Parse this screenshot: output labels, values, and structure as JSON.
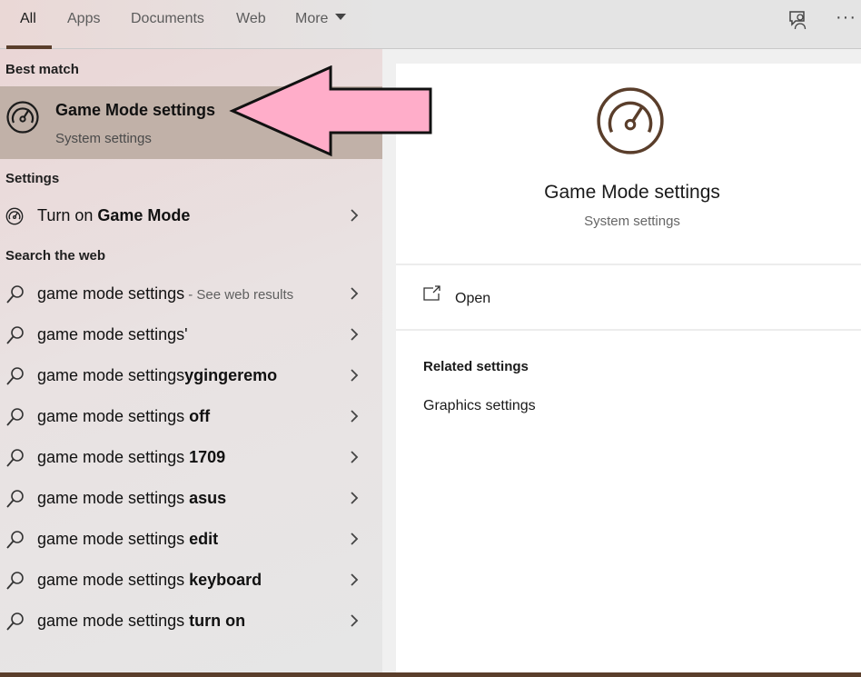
{
  "tabs": [
    {
      "label": "All",
      "active": true
    },
    {
      "label": "Apps"
    },
    {
      "label": "Documents"
    },
    {
      "label": "Web"
    },
    {
      "label": "More"
    }
  ],
  "top_icons": [
    "feedback-icon",
    "more-options-icon"
  ],
  "top_more_glyph": "···",
  "sections": {
    "best_match": "Best match",
    "settings": "Settings",
    "search_web": "Search the web"
  },
  "best_match": {
    "title": "Game Mode settings",
    "subtitle": "System settings",
    "icon": "speedometer-icon"
  },
  "settings_result": {
    "prefix": "Turn on ",
    "bold": "Game Mode"
  },
  "web_results": [
    {
      "prefix": "game mode settings",
      "bold": "",
      "hint": " - See web results"
    },
    {
      "prefix": "game mode settings'",
      "bold": "",
      "hint": ""
    },
    {
      "prefix": "game mode settings",
      "bold": "ygingeremo",
      "hint": ""
    },
    {
      "prefix": "game mode settings ",
      "bold": "off",
      "hint": ""
    },
    {
      "prefix": "game mode settings ",
      "bold": "1709",
      "hint": ""
    },
    {
      "prefix": "game mode settings ",
      "bold": "asus",
      "hint": ""
    },
    {
      "prefix": "game mode settings ",
      "bold": "edit",
      "hint": ""
    },
    {
      "prefix": "game mode settings ",
      "bold": "keyboard",
      "hint": ""
    },
    {
      "prefix": "game mode settings ",
      "bold": "turn on",
      "hint": ""
    }
  ],
  "preview": {
    "title": "Game Mode settings",
    "subtitle": "System settings",
    "open_label": "Open",
    "related_title": "Related settings",
    "related_items": [
      "Graphics settings"
    ]
  },
  "colors": {
    "accent": "#5a3e2b",
    "best_match_bg": "#c1b1a8",
    "annotation_arrow": "#ffadc9"
  }
}
